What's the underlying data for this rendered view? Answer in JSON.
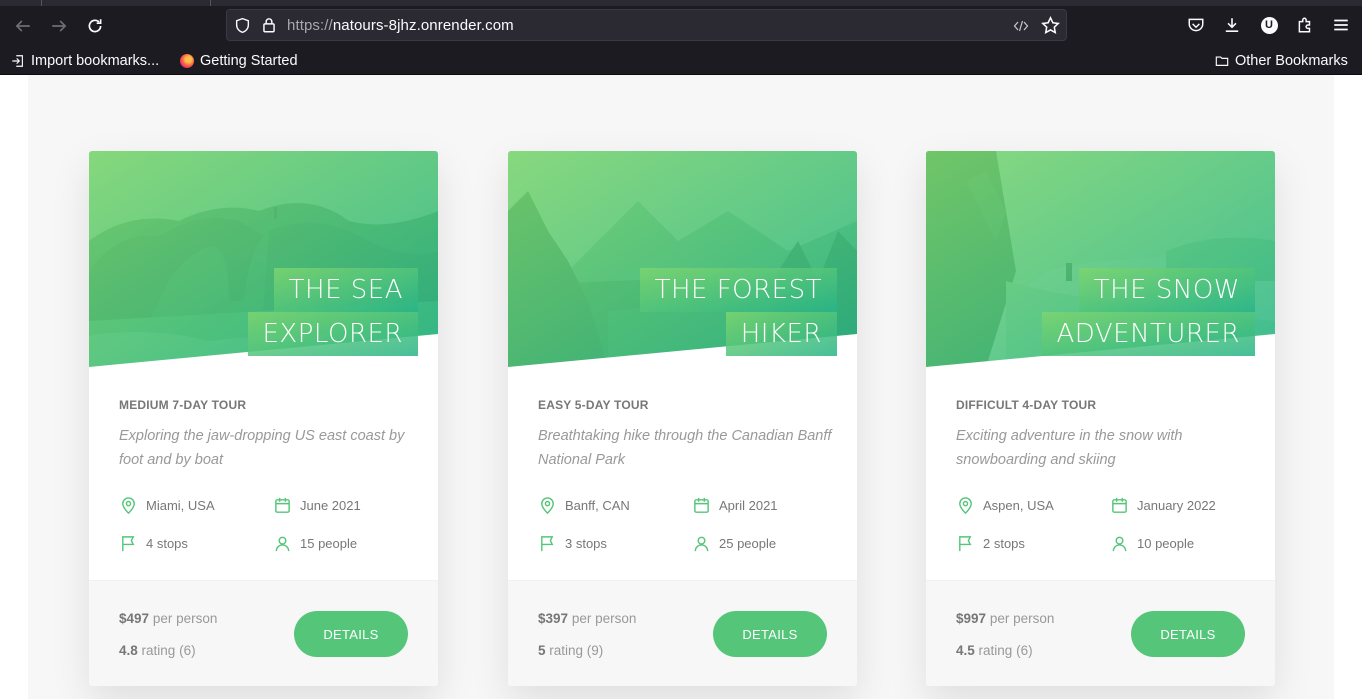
{
  "browser": {
    "url_prefix": "https://",
    "url_host": "natours-8jhz.onrender.com",
    "bookmarks": [
      {
        "label": "Import bookmarks..."
      },
      {
        "label": "Getting Started"
      }
    ],
    "other_bookmarks": "Other Bookmarks",
    "extension_badge": "U"
  },
  "cards": [
    {
      "title_line1": "The Sea",
      "title_line2": "Explorer",
      "subheading": "Medium 7-day tour",
      "summary": "Exploring the jaw-dropping US east coast by foot and by boat",
      "location": "Miami, USA",
      "date": "June 2021",
      "stops": "4 stops",
      "people": "15 people",
      "price": "$497",
      "price_unit": "per person",
      "rating": "4.8",
      "rating_text": "rating (6)",
      "button": "Details"
    },
    {
      "title_line1": "The Forest",
      "title_line2": "Hiker",
      "subheading": "Easy 5-day tour",
      "summary": "Breathtaking hike through the Canadian Banff National Park",
      "location": "Banff, CAN",
      "date": "April 2021",
      "stops": "3 stops",
      "people": "25 people",
      "price": "$397",
      "price_unit": "per person",
      "rating": "5",
      "rating_text": "rating (9)",
      "button": "Details"
    },
    {
      "title_line1": "The Snow",
      "title_line2": "Adventurer",
      "subheading": "Difficult 4-day tour",
      "summary": "Exciting adventure in the snow with snowboarding and skiing",
      "location": "Aspen, USA",
      "date": "January 2022",
      "stops": "2 stops",
      "people": "10 people",
      "price": "$997",
      "price_unit": "per person",
      "rating": "4.5",
      "rating_text": "rating (6)",
      "button": "Details"
    }
  ],
  "colors": {
    "brand_green": "#55c57a",
    "brand_green_light": "#7dd56f",
    "brand_green_dark": "#28b487"
  }
}
